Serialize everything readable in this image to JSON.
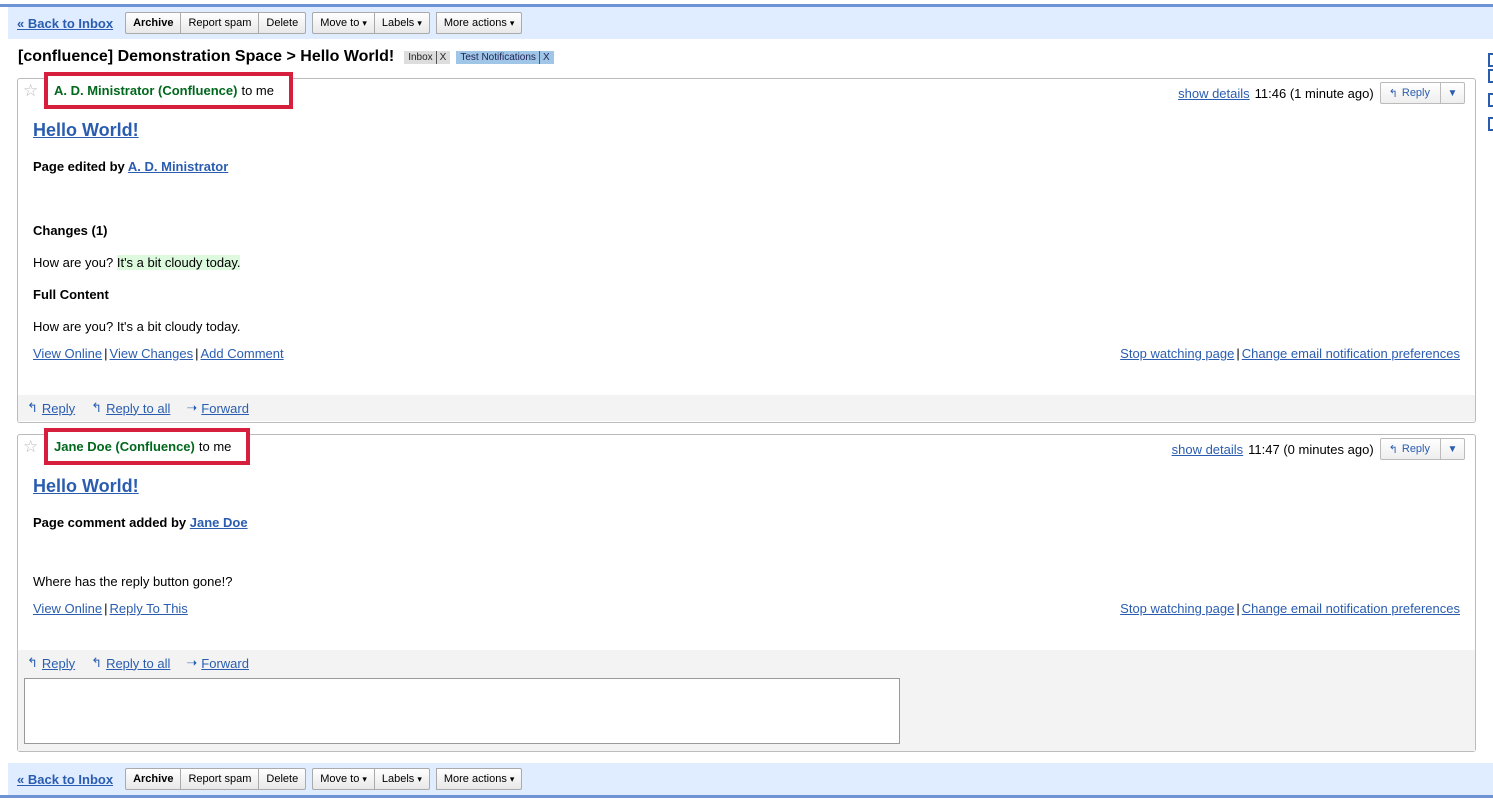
{
  "toolbar": {
    "back": "« Back to Inbox",
    "archive": "Archive",
    "report_spam": "Report spam",
    "delete": "Delete",
    "move_to": "Move to",
    "labels": "Labels",
    "more_actions": "More actions",
    "caret": "▾"
  },
  "thread": {
    "subject": "[confluence] Demonstration Space > Hello World!",
    "labels": [
      {
        "name": "Inbox",
        "remove": "X"
      },
      {
        "name": "Test Notifications",
        "remove": "X"
      }
    ]
  },
  "messages": [
    {
      "sender": "A. D. Ministrator (Confluence)",
      "to": "to me",
      "show_details": "show details",
      "time": "11:46 (1 minute ago)",
      "reply": "Reply",
      "title": "Hello World!",
      "edited_prefix": "Page edited by",
      "edited_by": "A. D. Ministrator",
      "changes_heading": "Changes (1)",
      "changes_plain": "How are you?",
      "changes_added": "It's a bit cloudy today.",
      "full_heading": "Full Content",
      "full_text": "How are you? It's a bit cloudy today.",
      "links": [
        "View Online",
        "View Changes",
        "Add Comment"
      ],
      "right_links": [
        "Stop watching page",
        "Change email notification preferences"
      ]
    },
    {
      "sender": "Jane Doe (Confluence)",
      "to": "to me",
      "show_details": "show details",
      "time": "11:47 (0 minutes ago)",
      "reply": "Reply",
      "title": "Hello World!",
      "comment_prefix": "Page comment added by",
      "comment_by": "Jane Doe",
      "comment_text": "Where has the reply button gone!?",
      "links": [
        "View Online",
        "Reply To This"
      ],
      "right_links": [
        "Stop watching page",
        "Change email notification preferences"
      ]
    }
  ],
  "footer_actions": {
    "reply": "Reply",
    "reply_all": "Reply to all",
    "forward": "Forward"
  },
  "icons": {
    "star": "☆",
    "reply": "↰",
    "reply_all": "↰",
    "forward": "➝",
    "dropdown": "▼"
  }
}
